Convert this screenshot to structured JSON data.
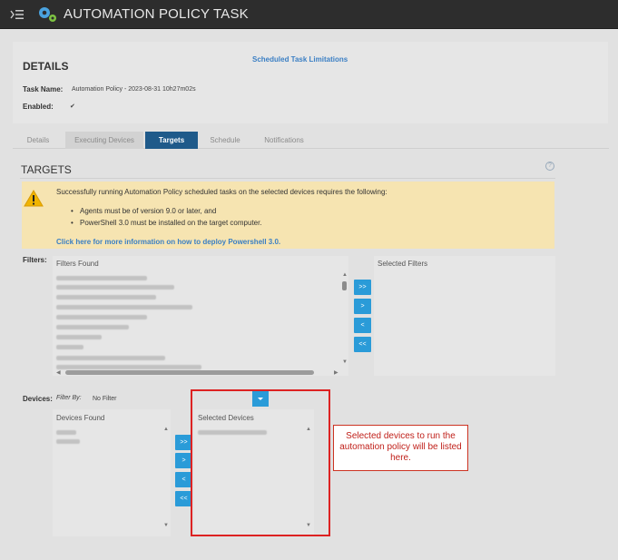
{
  "header": {
    "title": "AUTOMATION POLICY TASK",
    "menu_icon": "collapse-menu-icon",
    "logo_icon": "gears-icon"
  },
  "details": {
    "heading": "DETAILS",
    "scheduled_link": "Scheduled Task Limitations",
    "task_name_label": "Task Name:",
    "task_name_value": "Automation Policy - 2023-08-31 10h27m02s",
    "enabled_label": "Enabled:",
    "enabled_value": "✔"
  },
  "tabs": [
    {
      "label": "Details"
    },
    {
      "label": "Executing Devices"
    },
    {
      "label": "Targets"
    },
    {
      "label": "Schedule"
    },
    {
      "label": "Notifications"
    }
  ],
  "targets": {
    "heading": "TARGETS",
    "help": "?",
    "warning_text": "Successfully running Automation Policy scheduled tasks on the selected devices requires the following:",
    "requirements": [
      "Agents must be of version 9.0 or later, and",
      "PowerShell 3.0 must be installed on the target computer."
    ],
    "warning_link": "Click here for more information on how to deploy Powershell 3.0."
  },
  "filters": {
    "label": "Filters:",
    "found_header": "Filters Found",
    "selected_header": "Selected Filters",
    "buttons": [
      ">>",
      ">",
      "<",
      "<<"
    ]
  },
  "devices": {
    "label": "Devices:",
    "filter_by_label": "Filter By:",
    "filter_value": "No Filter",
    "found_header": "Devices Found",
    "selected_header": "Selected Devices",
    "buttons": [
      ">>",
      ">",
      "<",
      "<<"
    ]
  },
  "callout": {
    "text": "Selected devices to run the automation policy will be listed here."
  },
  "colors": {
    "accent": "#2a9bd8",
    "active_tab": "#1f5a8a",
    "warning_bg": "#f6e4b1",
    "annotation": "#dd2222"
  }
}
